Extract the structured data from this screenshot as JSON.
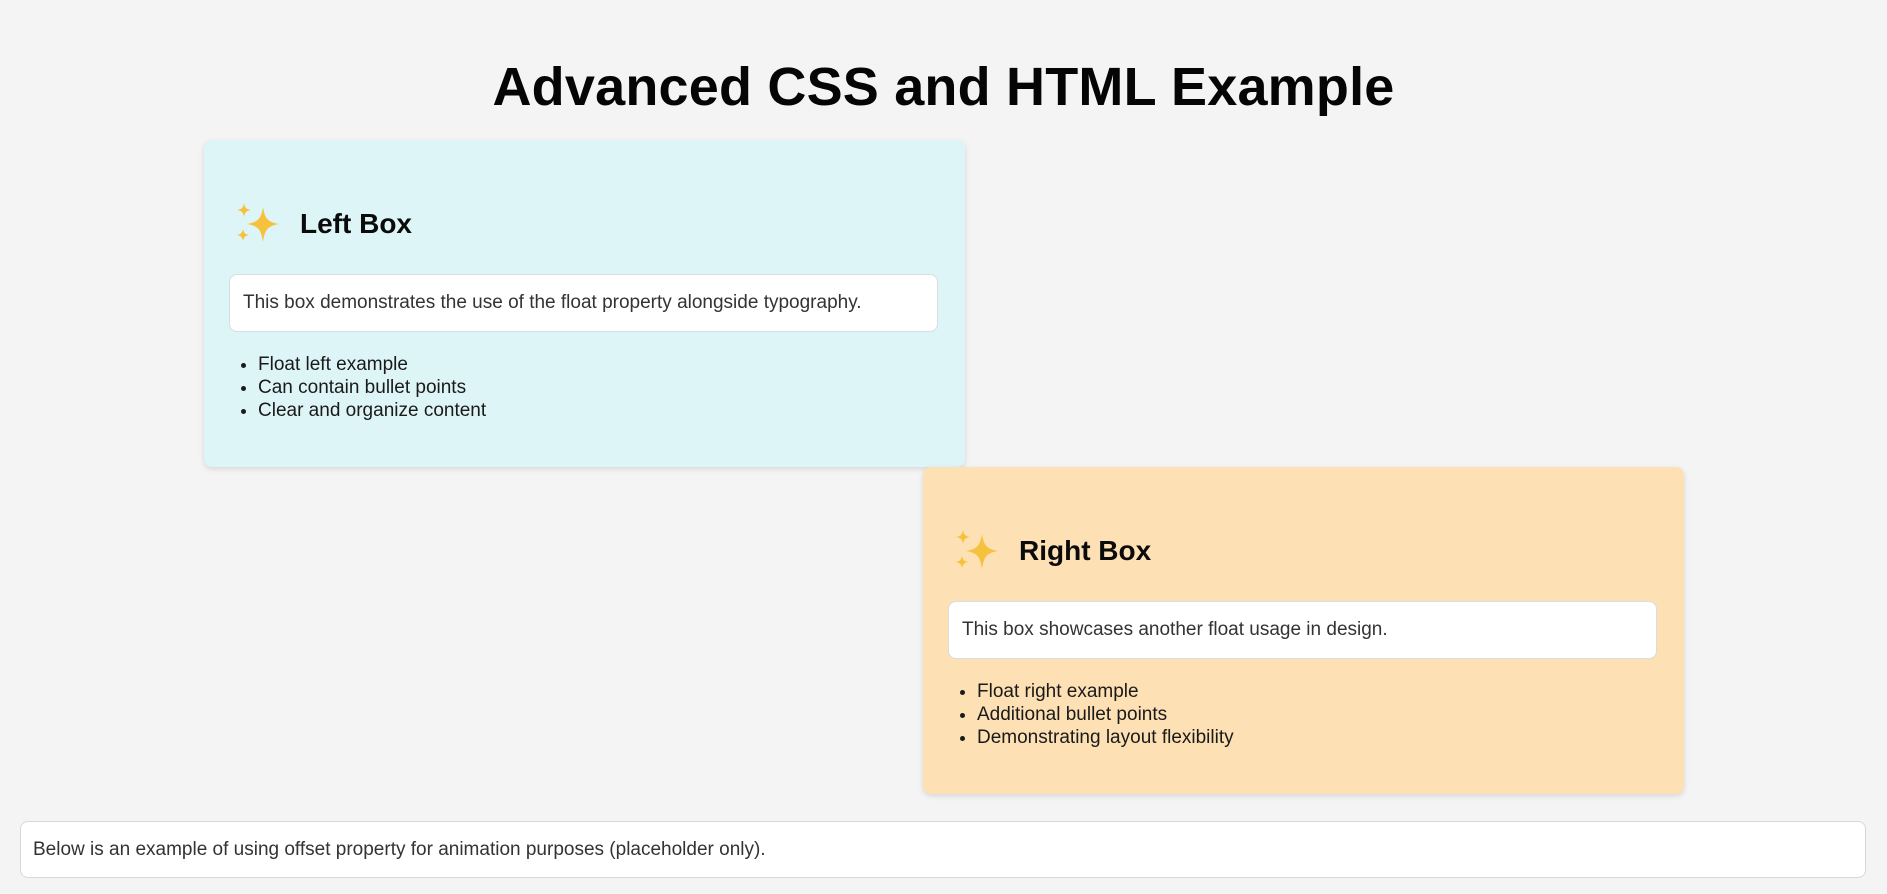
{
  "page": {
    "title": "Advanced CSS and HTML Example",
    "background": "#f4f4f4"
  },
  "left_box": {
    "icon": "sparkles-icon",
    "title": "Left Box",
    "description": "This box demonstrates the use of the float property alongside typography.",
    "items": [
      "Float left example",
      "Can contain bullet points",
      "Clear and organize content"
    ],
    "background": "#def5f8"
  },
  "right_box": {
    "icon": "sparkles-icon",
    "title": "Right Box",
    "description": "This box showcases another float usage in design.",
    "items": [
      "Float right example",
      "Additional bullet points",
      "Demonstrating layout flexibility"
    ],
    "background": "#fde0b3"
  },
  "footer": {
    "text": "Below is an example of using offset property for animation purposes (placeholder only)."
  }
}
